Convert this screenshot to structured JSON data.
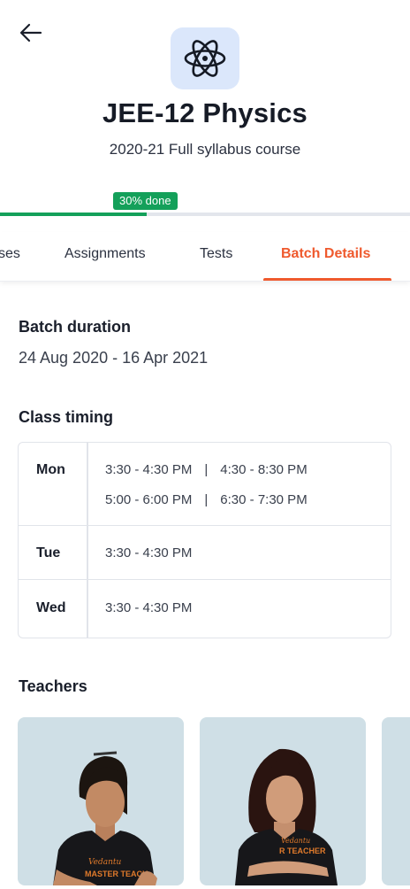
{
  "header": {
    "back_icon": "arrow-left-icon",
    "course_icon": "atom-icon",
    "title": "JEE-12 Physics",
    "subtitle": "2020-21 Full syllabus course"
  },
  "progress": {
    "badge_text": "30% done",
    "percent": 30,
    "fill_color": "#14a05a"
  },
  "tabs": [
    {
      "label": "ses",
      "active": false
    },
    {
      "label": "Assignments",
      "active": false
    },
    {
      "label": "Tests",
      "active": false
    },
    {
      "label": "Batch Details",
      "active": true
    }
  ],
  "accent_color": "#ef5a2e",
  "batch": {
    "duration_heading": "Batch duration",
    "duration_value": "24 Aug 2020 - 16 Apr 2021",
    "timing_heading": "Class timing",
    "schedule": [
      {
        "day": "Mon",
        "slots": [
          "3:30 - 4:30 PM",
          "4:30 - 8:30 PM",
          "5:00 - 6:00 PM",
          "6:30 - 7:30 PM"
        ]
      },
      {
        "day": "Tue",
        "slots": [
          "3:30 - 4:30 PM"
        ]
      },
      {
        "day": "Wed",
        "slots": [
          "3:30 - 4:30 PM"
        ]
      }
    ],
    "slot_separator": "|"
  },
  "teachers": {
    "heading": "Teachers",
    "cards": [
      {
        "shirt_text": "MASTER TEACH",
        "shirt_brand": "Vedantu"
      },
      {
        "shirt_text": "R TEACHER",
        "shirt_brand": "Vedantu"
      }
    ]
  }
}
